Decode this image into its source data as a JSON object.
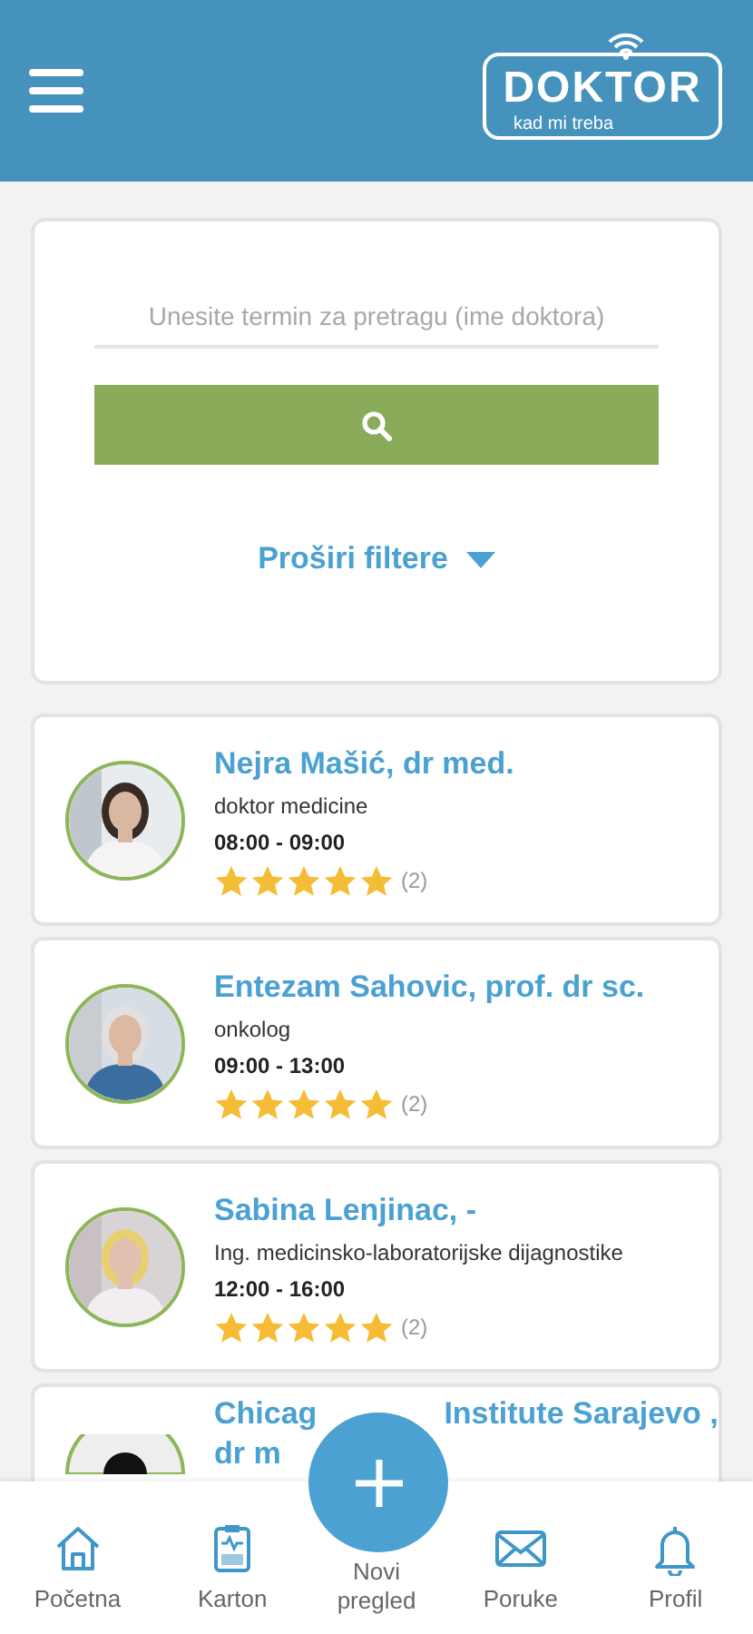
{
  "header": {
    "logo": {
      "title": "DOKTOR",
      "tagline": "kad mi treba"
    }
  },
  "search": {
    "placeholder": "Unesite termin za pretragu (ime doktora)",
    "expand_filters": "Proširi filtere"
  },
  "doctors": [
    {
      "kind": "full",
      "name": "Nejra Mašić, dr med.",
      "specialty": "doktor medicine",
      "hours": "08:00 - 09:00",
      "stars": 5,
      "review_count": "(2)"
    },
    {
      "kind": "full",
      "name": "Entezam Sahovic, prof. dr sc.",
      "specialty": "onkolog",
      "hours": "09:00 - 13:00",
      "stars": 5,
      "review_count": "(2)"
    },
    {
      "kind": "full",
      "name": "Sabina Lenjinac, -",
      "specialty": "Ing. medicinsko-laboratorijske dijagnostike",
      "hours": "12:00 - 16:00",
      "stars": 5,
      "review_count": "(2)"
    },
    {
      "kind": "partial",
      "name_fragments": [
        "Chicag",
        "Institute Sarajevo ,",
        "dr m"
      ]
    }
  ],
  "bottom_nav": [
    {
      "label": "Početna"
    },
    {
      "label": "Karton"
    },
    {
      "label": "Novi pregled"
    },
    {
      "label": "Poruke"
    },
    {
      "label": "Profil"
    }
  ]
}
